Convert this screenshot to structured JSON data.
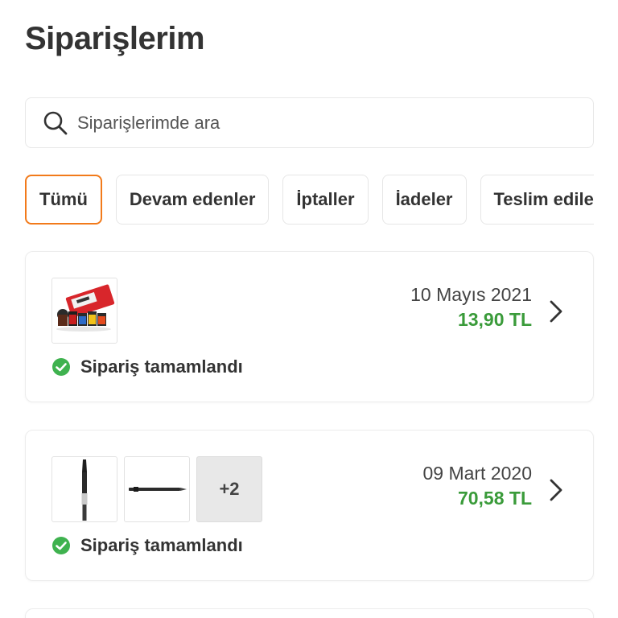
{
  "page": {
    "title": "Siparişlerim"
  },
  "search": {
    "placeholder": "Siparişlerimde ara"
  },
  "tabs": [
    {
      "label": "Tümü",
      "active": true
    },
    {
      "label": "Devam edenler",
      "active": false
    },
    {
      "label": "İptaller",
      "active": false
    },
    {
      "label": "İadeler",
      "active": false
    },
    {
      "label": "Teslim edilenler",
      "active": false
    }
  ],
  "orders": [
    {
      "date": "10 Mayıs 2021",
      "price": "13,90 TL",
      "status": "Sipariş tamamlandı",
      "thumbnails": [
        "paint-set-image"
      ],
      "more": ""
    },
    {
      "date": "09 Mart 2020",
      "price": "70,58 TL",
      "status": "Sipariş tamamlandı",
      "thumbnails": [
        "paint-brush-image",
        "pen-image"
      ],
      "more": "+2"
    }
  ],
  "colors": {
    "accent": "#f27a1a",
    "price": "#3a9b3a",
    "status_ok": "#3fb24f"
  },
  "icons": {
    "search": "search-icon",
    "chevron": "chevron-right-icon",
    "status": "check-circle-icon"
  }
}
